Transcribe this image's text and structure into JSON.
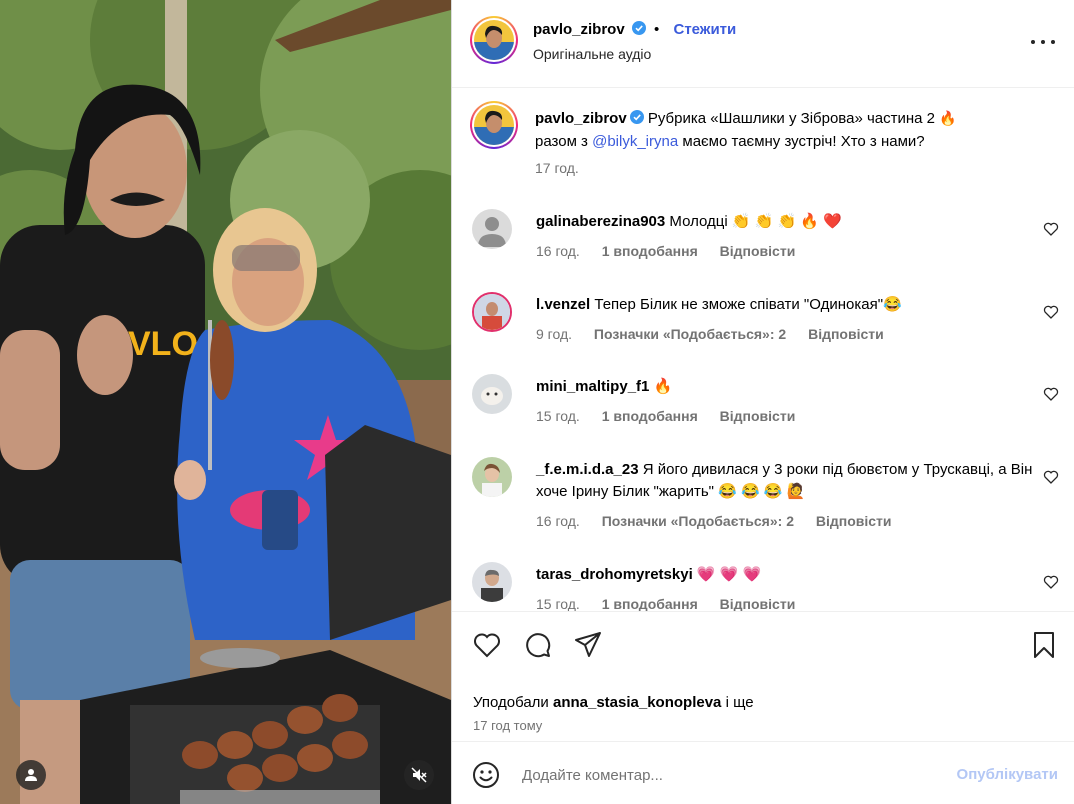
{
  "post": {
    "author": "pavlo_zibrov",
    "follow_label": "Стежити",
    "separator": "•",
    "audio": "Оригінальне аудіо"
  },
  "caption": {
    "author": "pavlo_zibrov",
    "text_part1": "Рубрика «Шашлики у Зіброва» частина 2",
    "emoji1": "🔥",
    "text_part2": "разом з",
    "mention": "@bilyk_iryna",
    "text_part3": "маємо таємну зустріч! Хто з нами?",
    "time": "17 год."
  },
  "comments": [
    {
      "user": "galinaberezina903",
      "text": "Молодці 👏 👏 👏 🔥 ❤️",
      "time": "16 год.",
      "likes": "1 вподобання",
      "reply": "Відповісти"
    },
    {
      "user": "l.venzel",
      "text": "Тепер Білик не зможе співати \"Одинокая\"😂",
      "time": "9 год.",
      "likes": "Позначки «Подобається»: 2",
      "reply": "Відповісти"
    },
    {
      "user": "mini_maltipy_f1",
      "text": "🔥",
      "time": "15 год.",
      "likes": "1 вподобання",
      "reply": "Відповісти"
    },
    {
      "user": "_f.e.m.i.d.a_23",
      "text": "Я його дивилася у 3 роки під бювєтом у Трускавці, а Він хоче Ірину Білик \"жарить\" 😂 😂 😂  🙋",
      "time": "16 год.",
      "likes": "Позначки «Подобається»: 2",
      "reply": "Відповісти"
    },
    {
      "user": "taras_drohomyretskyi",
      "text": "💗 💗 💗",
      "time": "15 год.",
      "likes": "1 вподобання",
      "reply": "Відповісти"
    }
  ],
  "likes": {
    "prefix": "Уподобали",
    "user": "anna_stasia_konopleva",
    "suffix": "і ще"
  },
  "post_time": "17 год тому",
  "composer": {
    "placeholder": "Додайте коментар...",
    "publish_label": "Опублікувати"
  },
  "colors": {
    "link": "#3b5bdb",
    "muted": "#737373",
    "publish_disabled": "#b3c7f5"
  },
  "icons": {
    "like": "heart-icon",
    "comment": "comment-icon",
    "share": "share-icon",
    "save": "bookmark-icon",
    "more": "more-options-icon",
    "emoji": "emoji-icon",
    "mute": "muted-speaker-icon",
    "tagged": "user-icon"
  }
}
